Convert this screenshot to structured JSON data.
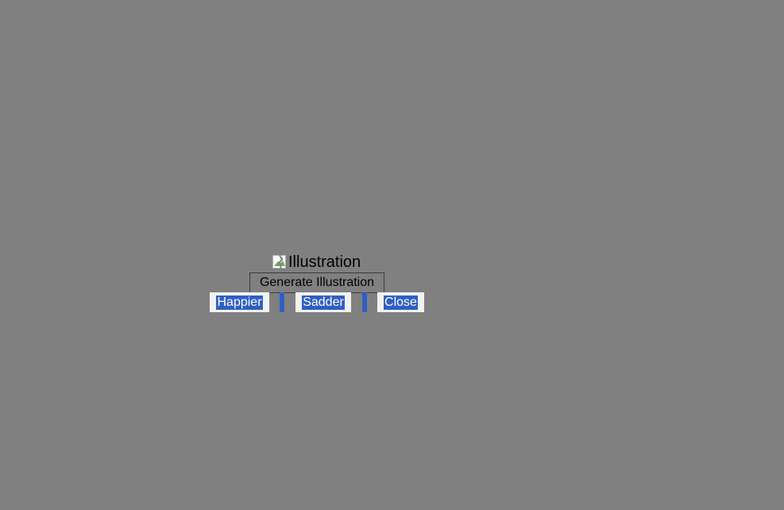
{
  "image": {
    "alt": "Illustration",
    "icon": "broken-image-icon"
  },
  "actions": {
    "generate_label": "Generate Illustration",
    "happier_label": "Happier",
    "sadder_label": "Sadder",
    "close_label": "Close"
  },
  "colors": {
    "background": "#808080",
    "selection": "#2f5fc4",
    "chip_background": "#f2f2f2"
  }
}
